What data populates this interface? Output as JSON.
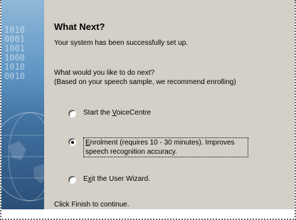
{
  "side_panel": {
    "binary_lines": [
      "1010",
      "0001",
      "1001",
      "1000",
      "1010",
      "0010"
    ]
  },
  "title": "What Next?",
  "intro": "Your system has been successfully set up.",
  "question": {
    "line1": "What would you like to do next?",
    "line2": "(Based on your speech sample, we recommend enrolling)"
  },
  "options": {
    "start": {
      "prefix": "Start the ",
      "accel": "V",
      "rest": "oiceCentre",
      "checked": false
    },
    "enrol": {
      "accel": "E",
      "rest": "nrolment (requires 10 - 30 minutes).  Improves speech recognition accuracy.",
      "checked": true
    },
    "exit": {
      "prefix": "E",
      "accel": "x",
      "rest": "it the User Wizard.",
      "checked": false
    }
  },
  "finish_text": "Click Finish to continue."
}
